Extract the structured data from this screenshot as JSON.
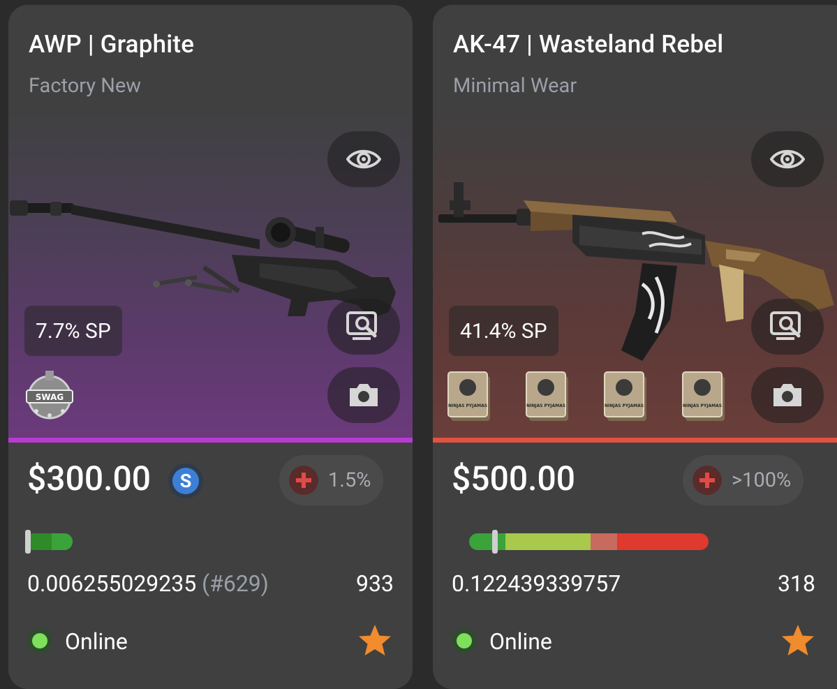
{
  "cards": [
    {
      "name": "AWP | Graphite",
      "wear": "Factory New",
      "sticker_pct": "7.7% SP",
      "price": "$300.00",
      "currency_badge": "S",
      "change": "1.5%",
      "float": "0.006255029235",
      "float_rank": "(#629)",
      "count": "933",
      "status": "Online",
      "stickers": [
        "SWAG"
      ],
      "rarity_color": "#b73bd0",
      "float_fraction": 0.006255029235
    },
    {
      "name": "AK-47 | Wasteland Rebel",
      "wear": "Minimal Wear",
      "sticker_pct": "41.4% SP",
      "price": "$500.00",
      "change": ">100%",
      "float": "0.122439339757",
      "count": "318",
      "status": "Online",
      "stickers": [
        "NINJAS PYJAMAS",
        "NINJAS PYJAMAS",
        "NINJAS PYJAMAS",
        "NINJAS PYJAMAS"
      ],
      "rarity_color": "#e2523e",
      "float_fraction": 0.122439339757
    }
  ],
  "icons": {
    "inspect": "eye-icon",
    "inspect_ingame": "screen-search-icon",
    "screenshot": "camera-icon",
    "favorite": "star-icon",
    "price_change": "plus-icon",
    "status": "online-dot-icon"
  },
  "colors": {
    "online": "#7ee05a",
    "star": "#f08b2e",
    "change_icon": "#e04b45"
  }
}
